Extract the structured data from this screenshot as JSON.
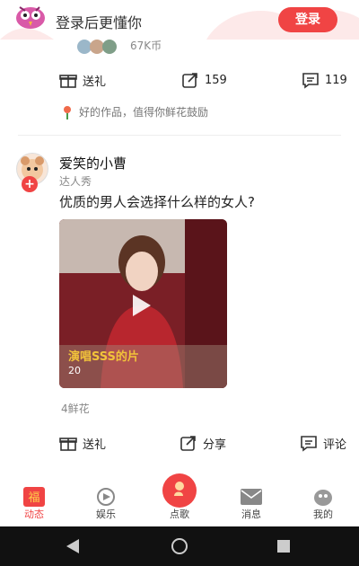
{
  "header": {
    "title": "登录后更懂你",
    "login_label": "登录"
  },
  "prev_post": {
    "coins": "67K币",
    "actions": {
      "gift_label": "送礼",
      "share_count": "159",
      "comment_count": "119"
    },
    "flower_text": "好的作品，值得你鲜花鼓励"
  },
  "post": {
    "author": "爱笑的小曹",
    "tag": "达人秀",
    "text": "优质的男人会选择什么样的女人?",
    "video": {
      "title": "演唱SSS的片",
      "views": "20"
    },
    "likes": "4鲜花",
    "actions": {
      "gift_label": "送礼",
      "share_label": "分享",
      "comment_label": "评论"
    }
  },
  "tabbar": {
    "tabs": [
      {
        "label": "动态"
      },
      {
        "label": "娱乐"
      },
      {
        "label": "点歌"
      },
      {
        "label": "消息"
      },
      {
        "label": "我的"
      }
    ]
  },
  "colors": {
    "accent": "#f04444",
    "video_bg": "#7a1f26"
  }
}
